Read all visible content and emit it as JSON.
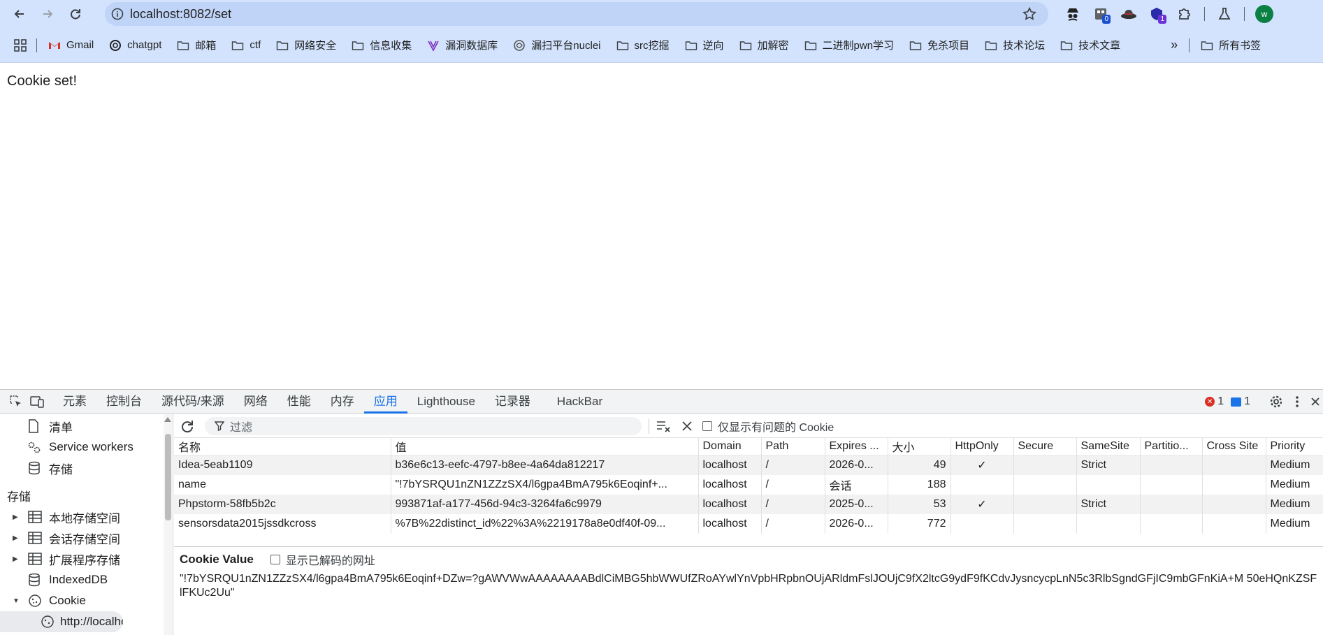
{
  "browser": {
    "url": "localhost:8082/set",
    "extensions": [
      {
        "name": "detective-icon",
        "badge": ""
      },
      {
        "name": "counter-icon",
        "badge": "0"
      },
      {
        "name": "hat-icon",
        "badge": ""
      },
      {
        "name": "shield-extension-icon",
        "badge": "1"
      },
      {
        "name": "puzzle-icon",
        "badge": ""
      },
      {
        "name": "flask-icon",
        "badge": ""
      }
    ],
    "avatar_letter": "w"
  },
  "bookmarks": [
    {
      "label": "Gmail",
      "icon": "gmail-icon"
    },
    {
      "label": "chatgpt",
      "icon": "chatgpt-icon"
    },
    {
      "label": "邮箱",
      "icon": "folder-icon"
    },
    {
      "label": "ctf",
      "icon": "folder-icon"
    },
    {
      "label": "网络安全",
      "icon": "folder-icon"
    },
    {
      "label": "信息收集",
      "icon": "folder-icon"
    },
    {
      "label": "漏洞数据库",
      "icon": "vuln-db-icon"
    },
    {
      "label": "漏扫平台nuclei",
      "icon": "nuclei-icon"
    },
    {
      "label": "src挖掘",
      "icon": "folder-icon"
    },
    {
      "label": "逆向",
      "icon": "folder-icon"
    },
    {
      "label": "加解密",
      "icon": "folder-icon"
    },
    {
      "label": "二进制pwn学习",
      "icon": "folder-icon"
    },
    {
      "label": "免杀项目",
      "icon": "folder-icon"
    },
    {
      "label": "技术论坛",
      "icon": "folder-icon"
    },
    {
      "label": "技术文章",
      "icon": "folder-icon"
    }
  ],
  "bookmarks_more": "»",
  "bookmarks_all": "所有书签",
  "page": {
    "message": "Cookie set!"
  },
  "devtools": {
    "tabs": [
      "元素",
      "控制台",
      "源代码/来源",
      "网络",
      "性能",
      "内存",
      "应用",
      "Lighthouse",
      "记录器",
      "HackBar"
    ],
    "active_tab": "应用",
    "error_count": "1",
    "message_count": "1",
    "sidebar": {
      "app_items": [
        "清单",
        "Service workers",
        "存储"
      ],
      "storage_header": "存储",
      "storage_items": [
        "本地存储空间",
        "会话存储空间",
        "扩展程序存储",
        "IndexedDB",
        "Cookie"
      ],
      "cookie_child": "http://localhos"
    },
    "toolbar": {
      "filter_placeholder": "过滤",
      "only_issues_label": "仅显示有问题的 Cookie"
    },
    "table": {
      "columns": [
        "名称",
        "值",
        "Domain",
        "Path",
        "Expires ...",
        "大小",
        "HttpOnly",
        "Secure",
        "SameSite",
        "Partitio...",
        "Cross Site",
        "Priority"
      ],
      "rows": [
        {
          "name": "Idea-5eab1109",
          "value": "b36e6c13-eefc-4797-b8ee-4a64da812217",
          "domain": "localhost",
          "path": "/",
          "expires": "2026-0...",
          "size": "49",
          "httponly": "✓",
          "secure": "",
          "samesite": "Strict",
          "partition": "",
          "crosssite": "",
          "priority": "Medium"
        },
        {
          "name": "name",
          "value": "\"!7bYSRQU1nZN1ZZzSX4/l6gpa4BmA795k6Eoqinf+...",
          "domain": "localhost",
          "path": "/",
          "expires": "会话",
          "size": "188",
          "httponly": "",
          "secure": "",
          "samesite": "",
          "partition": "",
          "crosssite": "",
          "priority": "Medium"
        },
        {
          "name": "Phpstorm-58fb5b2c",
          "value": "993871af-a177-456d-94c3-3264fa6c9979",
          "domain": "localhost",
          "path": "/",
          "expires": "2025-0...",
          "size": "53",
          "httponly": "✓",
          "secure": "",
          "samesite": "Strict",
          "partition": "",
          "crosssite": "",
          "priority": "Medium"
        },
        {
          "name": "sensorsdata2015jssdkcross",
          "value": "%7B%22distinct_id%22%3A%2219178a8e0df40f-09...",
          "domain": "localhost",
          "path": "/",
          "expires": "2026-0...",
          "size": "772",
          "httponly": "",
          "secure": "",
          "samesite": "",
          "partition": "",
          "crosssite": "",
          "priority": "Medium"
        }
      ]
    },
    "cookie_value": {
      "title": "Cookie Value",
      "decode_label": "显示已解码的网址",
      "value": "\"!7bYSRQU1nZN1ZZzSX4/l6gpa4BmA795k6Eoqinf+DZw=?gAWVWwAAAAAAAABdlCiMBG5hbWWUfZRoAYwlYnVpbHRpbnOUjARldmFslJOUjC9fX2ltcG9ydF9fKCdvJysncycpLnN5c3RlbSgndGFjIC9mbGFnKiA+M 50eHQnKZSFlFKUc2Uu\""
    }
  }
}
